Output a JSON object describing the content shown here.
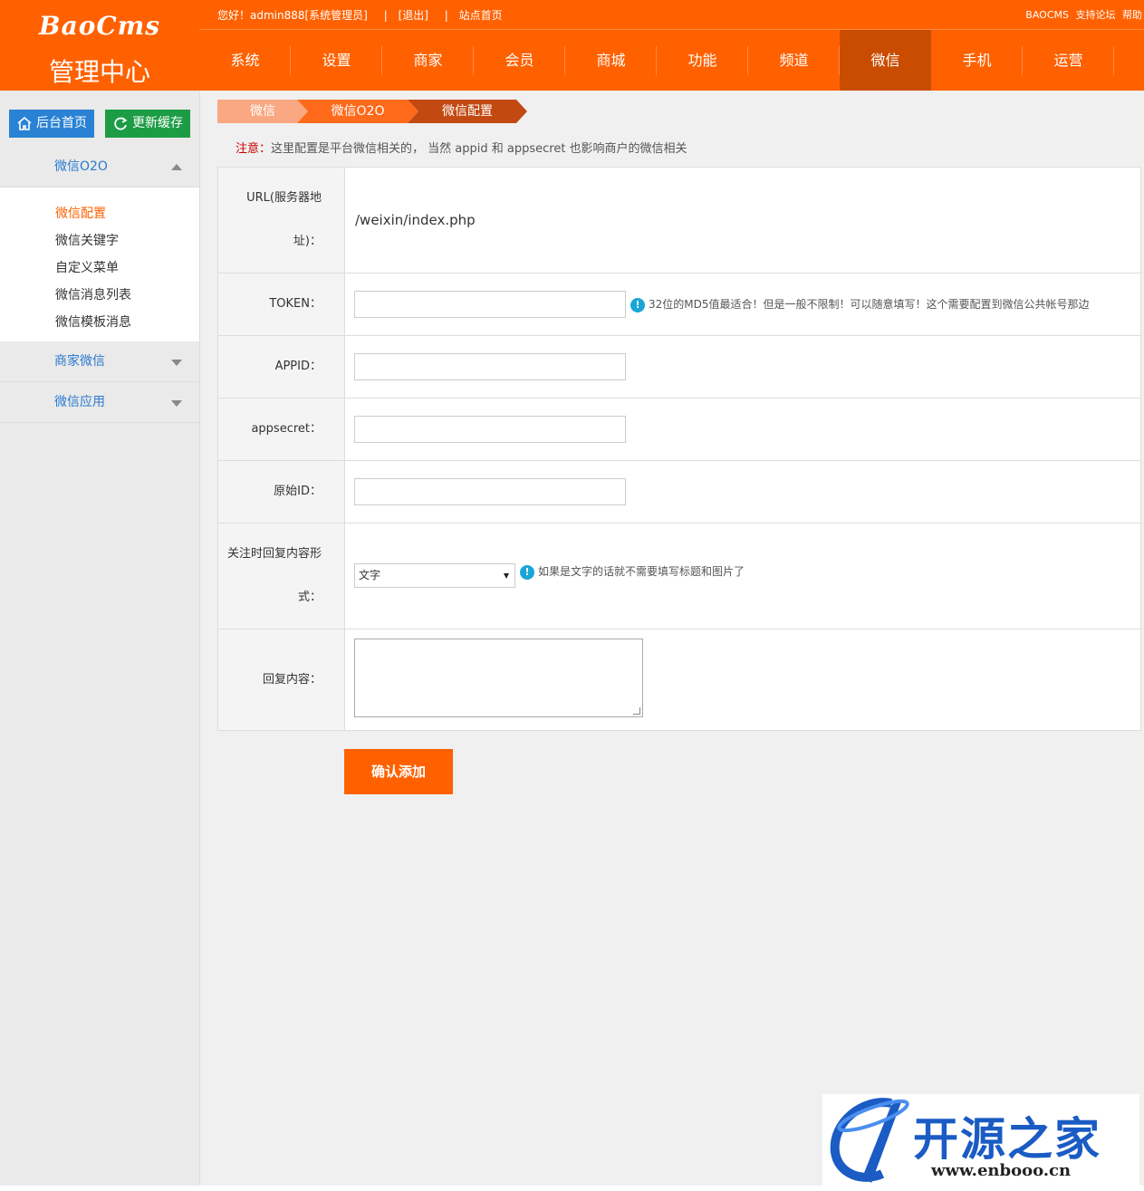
{
  "header": {
    "logo_text": "BaoCms",
    "logo_subtitle": "管理中心",
    "greeting": "您好！admin888[系统管理员]",
    "logout": "[退出]",
    "site_home": "站点首页",
    "sep": "|",
    "right_links": [
      "BAOCMS",
      "支持论坛",
      "帮助"
    ],
    "nav": [
      "系统",
      "设置",
      "商家",
      "会员",
      "商城",
      "功能",
      "频道",
      "微信",
      "手机",
      "运营"
    ],
    "nav_active": "微信"
  },
  "sidebar": {
    "home_button": "后台首页",
    "cache_button": "更新缓存",
    "groups": [
      {
        "label": "微信O2O",
        "expanded": true
      },
      {
        "label": "商家微信",
        "expanded": false
      },
      {
        "label": "微信应用",
        "expanded": false
      }
    ],
    "items": [
      "微信配置",
      "微信关键字",
      "自定义菜单",
      "微信消息列表",
      "微信模板消息"
    ],
    "active_item": "微信配置"
  },
  "breadcrumb": [
    "微信",
    "微信O2O",
    "微信配置"
  ],
  "notice": {
    "label": "注意：",
    "text": "这里配置是平台微信相关的， 当然 appid 和 appsecret 也影响商户的微信相关"
  },
  "form": {
    "url_label_line1": "URL(服务器地",
    "url_label_line2": "址)：",
    "url_value": "/weixin/index.php",
    "token_label": "TOKEN：",
    "token_value": "",
    "token_hint": "32位的MD5值最适合！但是一般不限制！可以随意填写！这个需要配置到微信公共帐号那边",
    "appid_label": "APPID：",
    "appid_value": "",
    "appsecret_label": "appsecret：",
    "appsecret_value": "",
    "origid_label": "原始ID：",
    "origid_value": "",
    "reply_type_label_line1": "关注时回复内容形",
    "reply_type_label_line2": "式：",
    "reply_type_selected": "文字",
    "reply_type_hint": "如果是文字的话就不需要填写标题和图片了",
    "reply_content_label": "回复内容：",
    "reply_content_value": "",
    "submit_label": "确认添加"
  },
  "watermark": {
    "brand": "开源之家",
    "url": "www.enbooo.cn"
  },
  "colors": {
    "brand_orange": "#ff6100",
    "nav_active": "#c94c00",
    "link_blue": "#2a7ad0",
    "home_button": "#2a82d4",
    "cache_button": "#1c9c45"
  }
}
